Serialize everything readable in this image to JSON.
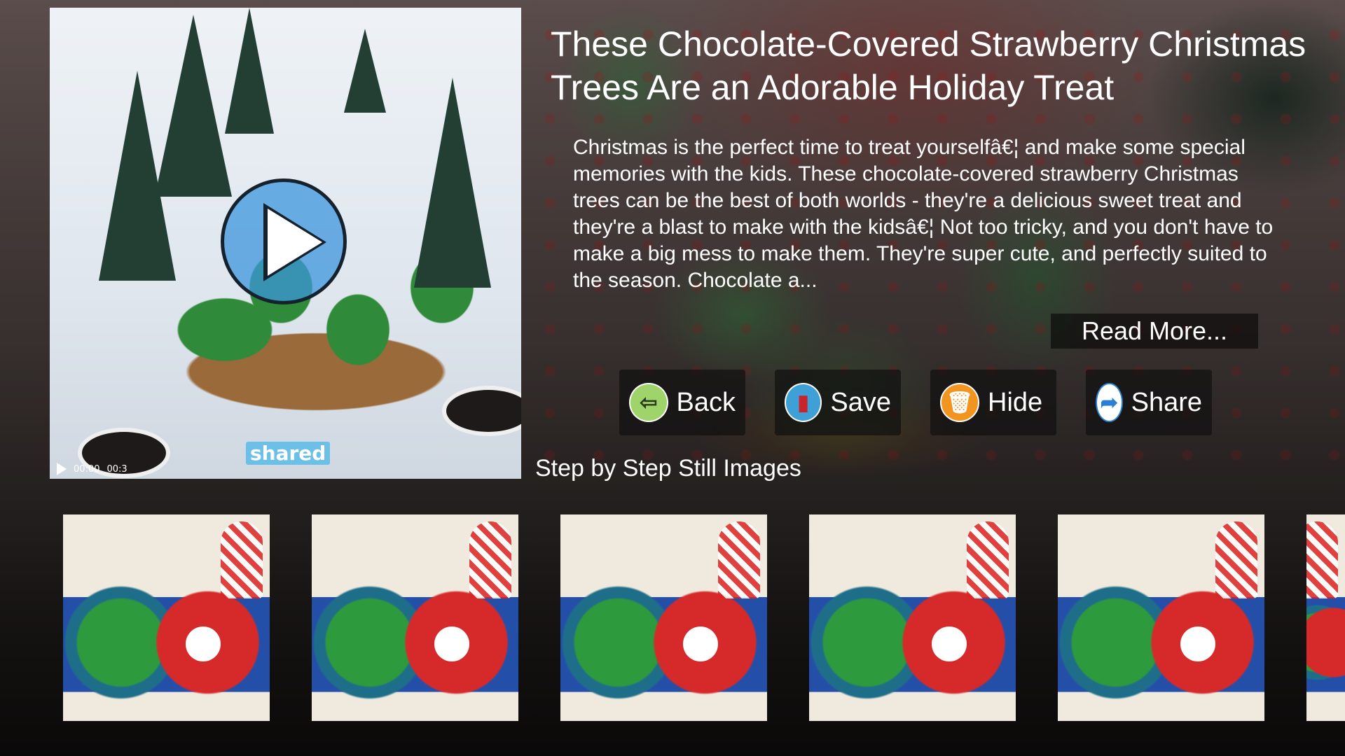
{
  "recipe": {
    "title": "These Chocolate-Covered Strawberry Christmas Trees Are an Adorable Holiday Treat",
    "description": "Christmas is the perfect time to treat yourselfâ€¦ and make some special memories with the kids. These chocolate-covered strawberry Christmas trees can be the best of both worlds - they're a delicious sweet treat and they're a blast to make with the kidsâ€¦ Not too tricky, and you don't have to make a big mess to make them. They're super cute, and perfectly suited to the season. Chocolate a...",
    "read_more_label": "Read More..."
  },
  "video": {
    "current_time": "00:00",
    "duration": "00:3",
    "watermark": "shared",
    "play_icon": "play-icon"
  },
  "actions": [
    {
      "label": "Back",
      "icon": "back-arrow-icon",
      "color": "#9ed46a"
    },
    {
      "label": "Save",
      "icon": "save-book-icon",
      "color": "#3fa0d8"
    },
    {
      "label": "Hide",
      "icon": "trash-can-icon",
      "color": "#f29420"
    },
    {
      "label": "Share",
      "icon": "share-arrow-icon",
      "color": "#2a7fd4"
    }
  ],
  "steps": {
    "heading": "Step by Step Still Images"
  }
}
